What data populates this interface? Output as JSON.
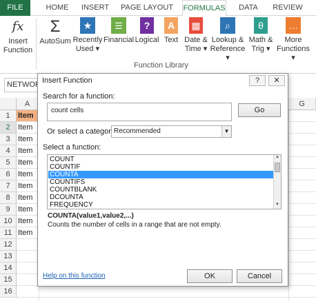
{
  "ribbon_tabs": [
    "FILE",
    "HOME",
    "INSERT",
    "PAGE LAYOUT",
    "FORMULAS",
    "DATA",
    "REVIEW"
  ],
  "ribbon_buttons": {
    "insert_function": [
      "Insert",
      "Function"
    ],
    "autosum": [
      "AutoSum",
      ""
    ],
    "recently_used": [
      "Recently",
      "Used ▾"
    ],
    "financial": [
      "Financial",
      ""
    ],
    "logical": [
      "Logical",
      ""
    ],
    "text": [
      "Text",
      ""
    ],
    "date_time": [
      "Date &",
      "Time ▾"
    ],
    "lookup_reference": [
      "Lookup &",
      "Reference ▾"
    ],
    "math_trig": [
      "Math &",
      "Trig ▾"
    ],
    "more_functions": [
      "More",
      "Functions ▾"
    ]
  },
  "ribbon_icons": {
    "insert_function": "fx",
    "autosum": "Σ",
    "recently_used": "★",
    "financial": "☰",
    "logical": "?",
    "text": "A",
    "date_time": "▦",
    "lookup_reference": "⌕",
    "math_trig": "θ",
    "more_functions": "…"
  },
  "group_label": "Function Library",
  "name_box": "NETWORK",
  "grid": {
    "col_headers": [
      "A",
      "G"
    ],
    "rows": [
      "1",
      "2",
      "3",
      "4",
      "5",
      "6",
      "7",
      "8",
      "9",
      "10",
      "11",
      "12",
      "13",
      "14",
      "15",
      "16"
    ],
    "col_a": [
      "Item",
      "Item",
      "Item",
      "Item",
      "Item",
      "Item",
      "Item",
      "Item",
      "Item",
      "Item",
      "Item"
    ]
  },
  "dialog": {
    "title": "Insert Function",
    "help_btn": "?",
    "close_btn": "✕",
    "search_label": "Search for a function:",
    "search_value": "count cells",
    "go_btn": "Go",
    "category_label": "Or select a category:",
    "category_value": "Recommended",
    "select_label": "Select a function:",
    "functions": [
      "COUNT",
      "COUNTIF",
      "COUNTA",
      "COUNTIFS",
      "COUNTBLANK",
      "DCOUNTA",
      "FREQUENCY"
    ],
    "selected_index": 2,
    "signature": "COUNTA(value1,value2,...)",
    "description": "Counts the number of cells in a range that are not empty.",
    "help_link": "Help on this function",
    "ok_btn": "OK",
    "cancel_btn": "Cancel"
  },
  "colors": {
    "excel_green": "#217346",
    "header_cell": "#f4b183",
    "selection": "#3399ff"
  }
}
